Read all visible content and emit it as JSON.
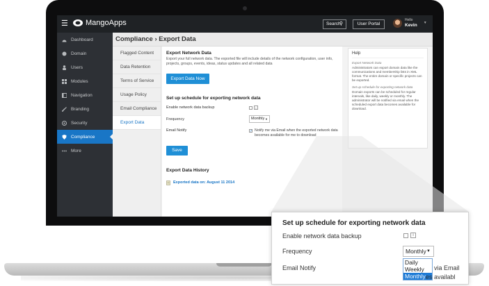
{
  "topbar": {
    "logo_text": "MangoApps",
    "search_label": "Search",
    "user_portal_label": "User Portal",
    "user_greeting": "Hello",
    "user_name": "Kevin"
  },
  "sidebar": {
    "items": [
      {
        "label": "Dashboard",
        "icon": "dashboard-icon"
      },
      {
        "label": "Domain",
        "icon": "globe-icon"
      },
      {
        "label": "Users",
        "icon": "user-icon"
      },
      {
        "label": "Modules",
        "icon": "modules-icon"
      },
      {
        "label": "Navigation",
        "icon": "navigation-icon"
      },
      {
        "label": "Branding",
        "icon": "brush-icon"
      },
      {
        "label": "Security",
        "icon": "lock-icon"
      },
      {
        "label": "Compliance",
        "icon": "shield-icon",
        "active": true
      },
      {
        "label": "More",
        "icon": "more-icon"
      }
    ]
  },
  "page": {
    "title": "Compliance › Export Data"
  },
  "subnav": {
    "items": [
      "Flagged Content",
      "Data Retention",
      "Terms of Service",
      "Usage Policy",
      "Email Compliance",
      "Export Data"
    ],
    "active_index": 5
  },
  "export": {
    "heading": "Export Network Data",
    "description": "Export your full network data. The exported file will include details of the network configuration, user info, projects, groups, events, ideas, status updates and all related data",
    "button_label": "Export Data Now",
    "schedule_heading": "Set up schedule for exporting network data",
    "backup_label": "Enable network data backup",
    "frequency_label": "Frequency",
    "frequency_value": "Monthly",
    "email_label": "Email Notify",
    "email_text": "Notify me via Email when the exported network data becomes available for me to download",
    "save_label": "Save",
    "history_heading": "Export Data History",
    "history_item": "Exported data on: August 11 2014"
  },
  "help": {
    "title": "Help",
    "s1_title": "Export Network Data",
    "s1_text": "Administrators can export domain data like the communications and membership lists in XML format. The entire domain or specific projects can be exported.",
    "s2_title": "Set up schedule for exporting network data",
    "s2_text": "Domain exports can be scheduled for regular intervals, like daily, weekly or monthly. The administrator will be notified via email when the scheduled export data becomes available for download."
  },
  "zoom": {
    "heading": "Set up schedule for exporting network data",
    "backup_label": "Enable network data backup",
    "frequency_label": "Frequency",
    "frequency_value": "Monthly",
    "email_label": "Email Notify",
    "options": [
      "Daily",
      "Weekly",
      "Monthly"
    ],
    "selected_option": "Monthly",
    "trail_1": "via Email",
    "trail_2": "es availabl"
  },
  "colors": {
    "accent": "#1976c6",
    "topbar": "#1f2225",
    "sidebar": "#2d3035"
  }
}
